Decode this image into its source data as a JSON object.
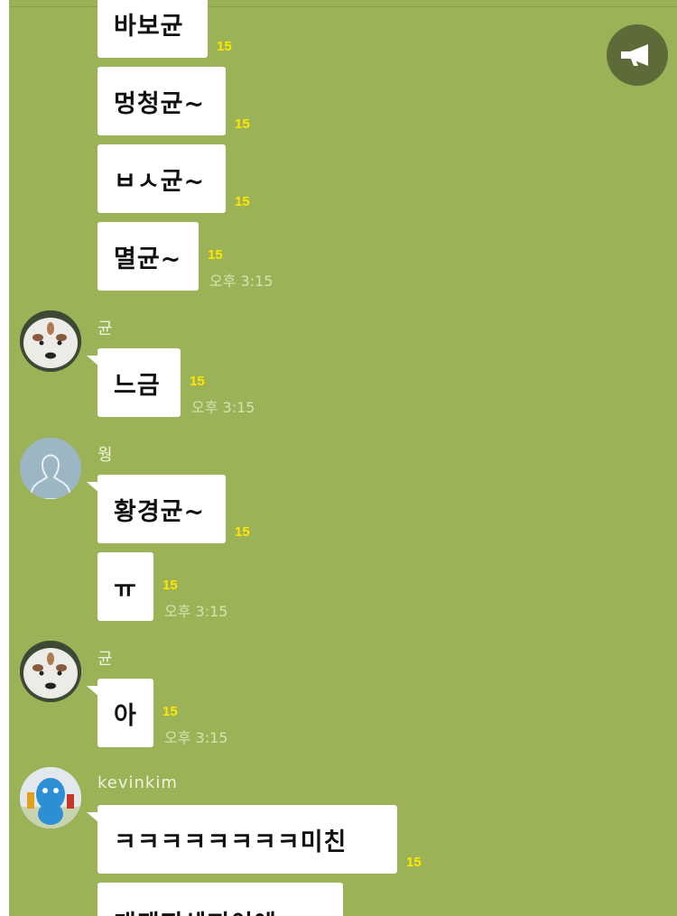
{
  "screen": {
    "notice_icon": "megaphone-icon"
  },
  "messages": [
    {
      "text": "바보균",
      "count": "15"
    },
    {
      "text": "멍청균~",
      "count": "15"
    },
    {
      "text": "ㅂㅅ균~",
      "count": "15"
    },
    {
      "text": "멸균~",
      "count": "15",
      "time": "오후 3:15"
    }
  ],
  "groups": [
    {
      "sender": "균",
      "avatar": "panda-avatar",
      "messages": [
        {
          "text": "느금",
          "count": "15",
          "time": "오후 3:15"
        }
      ]
    },
    {
      "sender": "웡",
      "avatar": "default-person-avatar",
      "messages": [
        {
          "text": "황경균~",
          "count": "15"
        },
        {
          "text": "ㅠ",
          "count": "15",
          "time": "오후 3:15"
        }
      ]
    },
    {
      "sender": "균",
      "avatar": "panda-avatar",
      "messages": [
        {
          "text": "아",
          "count": "15",
          "time": "오후 3:15"
        }
      ]
    },
    {
      "sender": "kevinkim",
      "avatar": "blue-character-avatar",
      "messages": [
        {
          "text": "ㅋㅋㅋㅋㅋㅋㅋㅋ미친",
          "count": "15"
        },
        {
          "text": "개돼지쉐끼이에",
          "count": ""
        }
      ]
    }
  ],
  "colors": {
    "background": "#9bb356",
    "bubble": "#ffffff",
    "read_count": "#ffe600",
    "timestamp": "#d7e2b1"
  }
}
